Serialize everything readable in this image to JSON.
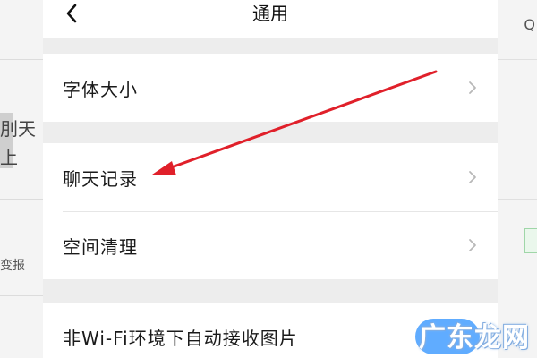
{
  "navbar": {
    "title": "通用",
    "back_icon": "chevron-left-icon"
  },
  "settings": {
    "font_size": "字体大小",
    "chat_history": "聊天记录",
    "storage_cleanup": "空间清理",
    "auto_download_images": "非Wi-Fi环境下自动接收图片"
  },
  "background_fragments": {
    "left_1": "刖天",
    "left_2": "上",
    "left_3": "变报",
    "right_1": "Q"
  },
  "annotation": {
    "type": "red-arrow",
    "target": "聊天记录",
    "color": "#e0202a"
  },
  "watermark": "广东龙网",
  "colors": {
    "accent_toggle": "#4fa3ff",
    "panel_bg": "#ededed",
    "row_bg": "#ffffff"
  }
}
